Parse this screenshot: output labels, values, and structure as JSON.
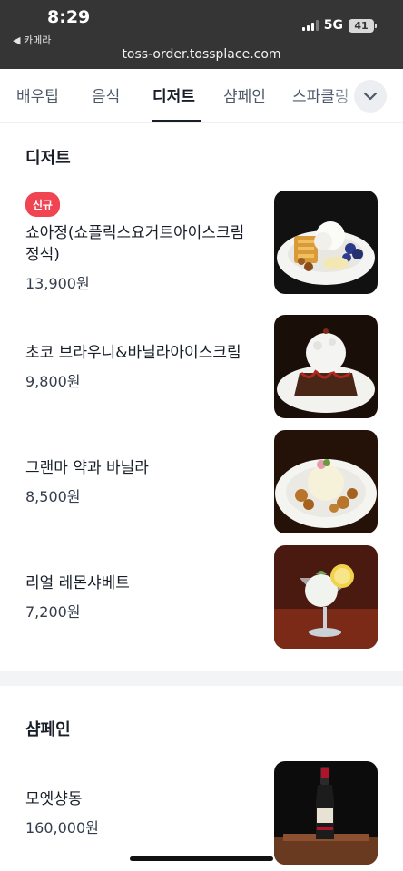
{
  "status_bar": {
    "time": "8:29",
    "back_label": "◀ 카메라",
    "network": "5G",
    "battery": "41",
    "url": "toss-order.tossplace.com"
  },
  "tabs": [
    {
      "label": "배우팁",
      "active": false
    },
    {
      "label": "음식",
      "active": false
    },
    {
      "label": "디저트",
      "active": true
    },
    {
      "label": "샴페인",
      "active": false
    },
    {
      "label": "스파클링",
      "active": false
    }
  ],
  "sections": [
    {
      "title": "디저트",
      "items": [
        {
          "badge": "신규",
          "name": "쇼아정(쇼플릭스요거트아이스크림 정석)",
          "price": "13,900원",
          "image": "yogurt-ice-cream-plate"
        },
        {
          "badge": "",
          "name": "초코 브라우니&바닐라아이스크림",
          "price": "9,800원",
          "image": "brownie-vanilla-ice-cream"
        },
        {
          "badge": "",
          "name": "그랜마 약과 바닐라",
          "price": "8,500원",
          "image": "yakgwa-vanilla"
        },
        {
          "badge": "",
          "name": "리얼 레몬샤베트",
          "price": "7,200원",
          "image": "lemon-sorbet-glass"
        }
      ]
    },
    {
      "title": "샴페인",
      "items": [
        {
          "badge": "",
          "name": "모엣샹동",
          "price": "160,000원",
          "image": "moet-champagne-bottle"
        }
      ]
    }
  ]
}
